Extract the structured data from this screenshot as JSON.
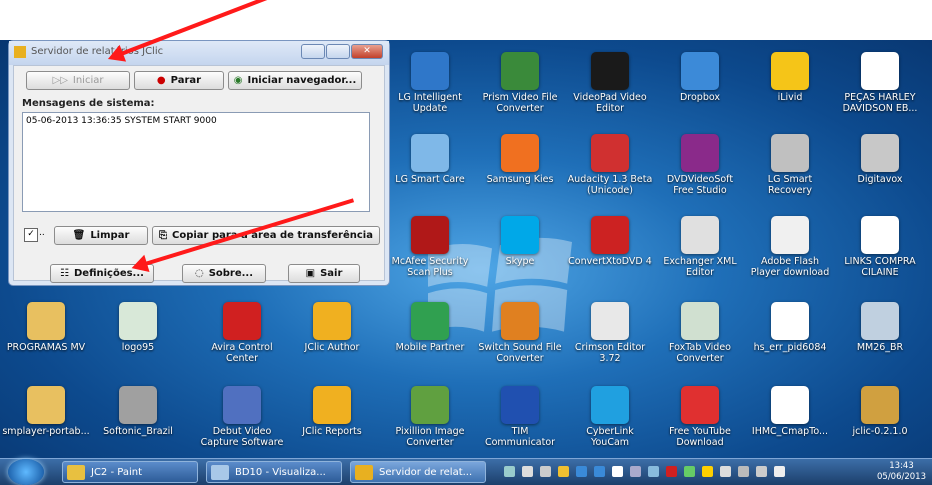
{
  "desktop": {
    "icons": [
      {
        "label": "LG Intelligent Update",
        "color": "#2f77c9"
      },
      {
        "label": "Prism Video File Converter",
        "color": "#3a8a3a"
      },
      {
        "label": "VideoPad Video Editor",
        "color": "#1a1a1a"
      },
      {
        "label": "Dropbox",
        "color": "#3c8ad8"
      },
      {
        "label": "iLivid",
        "color": "#f5c518"
      },
      {
        "label": "PEÇAS HARLEY DAVIDSON EB...",
        "color": "#ffffff"
      },
      {
        "label": "LG Smart Care",
        "color": "#7fb8e8"
      },
      {
        "label": "Samsung Kies",
        "color": "#f07020"
      },
      {
        "label": "Audacity 1.3 Beta (Unicode)",
        "color": "#d03030"
      },
      {
        "label": "DVDVideoSoft Free Studio",
        "color": "#8a2a8a"
      },
      {
        "label": "LG Smart Recovery",
        "color": "#c0c0c0"
      },
      {
        "label": "Digitavox",
        "color": "#c8c8c8"
      },
      {
        "label": "McAfee Security Scan Plus",
        "color": "#b01818"
      },
      {
        "label": "Skype",
        "color": "#00a8e8"
      },
      {
        "label": "ConvertXtoDVD 4",
        "color": "#cc2222"
      },
      {
        "label": "Exchanger XML Editor",
        "color": "#e0e0e0"
      },
      {
        "label": "Adobe Flash Player download",
        "color": "#f0f0f0"
      },
      {
        "label": "LINKS COMPRA CILAINE",
        "color": "#ffffff"
      },
      {
        "label": "PROGRAMAS MV",
        "color": "#e8c060"
      },
      {
        "label": "logo95",
        "color": "#d8e8d8"
      },
      {
        "label": "Avira Control Center",
        "color": "#d02020"
      },
      {
        "label": "JClic Author",
        "color": "#f0b020"
      },
      {
        "label": "Mobile Partner",
        "color": "#30a050"
      },
      {
        "label": "Switch Sound File Converter",
        "color": "#e08020"
      },
      {
        "label": "Crimson Editor 3.72",
        "color": "#e8e8e8"
      },
      {
        "label": "FoxTab Video Converter",
        "color": "#d0e0d0"
      },
      {
        "label": "hs_err_pid6084",
        "color": "#ffffff"
      },
      {
        "label": "MM26_BR",
        "color": "#c0d0e0"
      },
      {
        "label": "smplayer-portab...",
        "color": "#e8c060"
      },
      {
        "label": "Softonic_Brazil",
        "color": "#a0a0a0"
      },
      {
        "label": "Debut Video Capture Software",
        "color": "#5070c0"
      },
      {
        "label": "JClic Reports",
        "color": "#f0b020"
      },
      {
        "label": "Pixillion Image Converter",
        "color": "#60a040"
      },
      {
        "label": "TIM Communicator",
        "color": "#2050b0"
      },
      {
        "label": "CyberLink YouCam",
        "color": "#20a0e0"
      },
      {
        "label": "Free YouTube Download",
        "color": "#e03030"
      },
      {
        "label": "IHMC_CmapTo...",
        "color": "#ffffff"
      },
      {
        "label": "jclic-0.2.1.0",
        "color": "#d0a040"
      }
    ]
  },
  "dialog": {
    "title": "Servidor de relatórios JClic",
    "btn_iniciar": "Iniciar",
    "btn_parar": "Parar",
    "btn_navegador": "Iniciar navegador...",
    "messages_label": "Mensagens de sistema:",
    "messages_text": "05-06-2013 13:36:35 SYSTEM START 9000",
    "btn_limpar": "Limpar",
    "btn_copiar": "Copiar para a área de transferência",
    "btn_definicoes": "Definições...",
    "btn_sobre": "Sobre...",
    "btn_sair": "Sair",
    "checkbox_label": "..",
    "close_glyph": "✕"
  },
  "taskbar": {
    "items": [
      "JC2 - Paint",
      "BD10 - Visualiza...",
      "Servidor de relat..."
    ],
    "time": "13:43",
    "date": "05/06/2013"
  }
}
